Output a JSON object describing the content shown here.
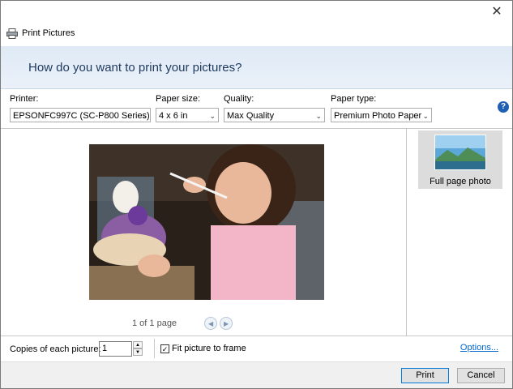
{
  "window": {
    "title": "Print Pictures",
    "close_glyph": "✕"
  },
  "banner": {
    "heading": "How do you want to print your pictures?"
  },
  "controls": {
    "printer": {
      "label": "Printer:",
      "value": "EPSONFC997C (SC-P800 Series)"
    },
    "paper_size": {
      "label": "Paper size:",
      "value": "4 x 6 in"
    },
    "quality": {
      "label": "Quality:",
      "value": "Max Quality"
    },
    "paper_type": {
      "label": "Paper type:",
      "value": "Premium Photo Paper"
    },
    "help_glyph": "?"
  },
  "preview": {
    "pager_text": "1 of 1 page",
    "prev_glyph": "◀",
    "next_glyph": "▶"
  },
  "layouts": [
    {
      "label": "Full page photo",
      "selected": true
    }
  ],
  "bottom": {
    "copies_label": "Copies of each picture:",
    "copies_value": "1",
    "fit_label": "Fit picture to frame",
    "fit_checked": "✓",
    "options_link": "Options..."
  },
  "footer": {
    "print_label": "Print",
    "cancel_label": "Cancel"
  },
  "icons": {
    "printer": "printer-icon",
    "chevron": "chevron-down-icon",
    "help": "help-icon"
  },
  "colors": {
    "banner_text": "#1e395b",
    "link": "#0066cc",
    "help": "#1f5fb4",
    "primary_border": "#0078d7"
  }
}
